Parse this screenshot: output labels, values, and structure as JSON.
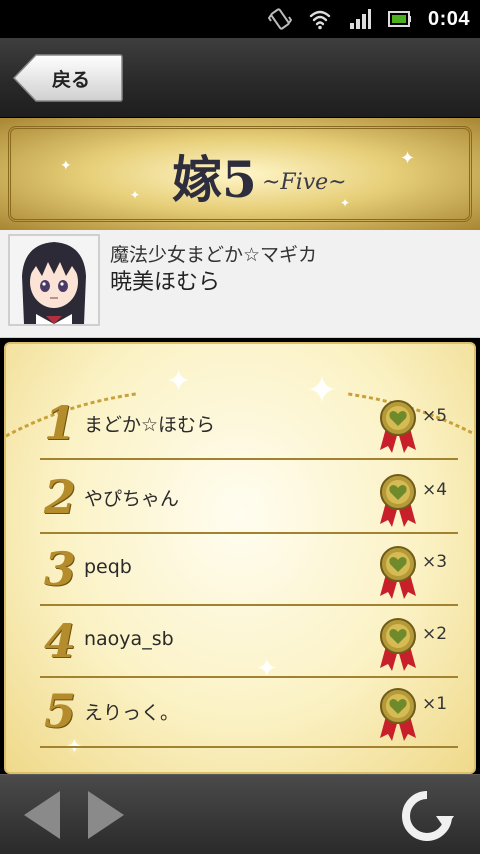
{
  "status_bar": {
    "time": "0:04",
    "icons": [
      "vibrate-icon",
      "wifi-icon",
      "signal-icon",
      "battery-icon"
    ]
  },
  "toolbar": {
    "back_label": "戻る"
  },
  "banner": {
    "logo_main": "嫁5",
    "logo_sub": "~Five~"
  },
  "character": {
    "series": "魔法少女まどか☆マギカ",
    "name": "暁美ほむら"
  },
  "ranking": [
    {
      "rank": "1",
      "name": "まどか☆ほむら",
      "count": "×5"
    },
    {
      "rank": "2",
      "name": "やぴちゃん",
      "count": "×4"
    },
    {
      "rank": "3",
      "name": "peqb",
      "count": "×3"
    },
    {
      "rank": "4",
      "name": "naoya_sb",
      "count": "×2"
    },
    {
      "rank": "5",
      "name": "えりっく。",
      "count": "×1"
    }
  ],
  "bottom_bar": {
    "icons": [
      "back-arrow-icon",
      "forward-arrow-icon",
      "refresh-icon"
    ]
  },
  "colors": {
    "gold": "#b48c2c",
    "gold_light": "#fbf2c5",
    "toolbar": "#2a2a2a"
  }
}
